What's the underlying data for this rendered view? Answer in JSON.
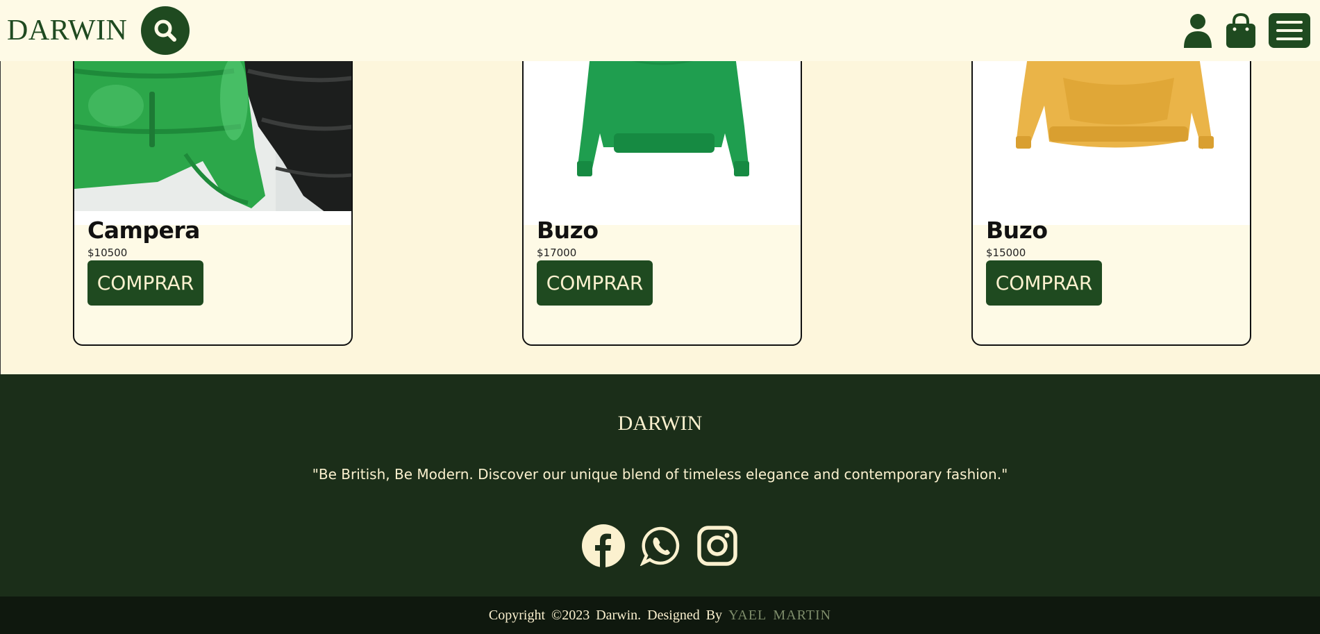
{
  "header": {
    "brand": "DARWIN",
    "icons": [
      "search-icon",
      "user-icon",
      "shopping-bag-icon",
      "menu-icon"
    ]
  },
  "products": [
    {
      "title": "Campera",
      "price": "$10500",
      "button": "COMPRAR",
      "image": "green-puffer-jacket"
    },
    {
      "title": "Buzo",
      "price": "$17000",
      "button": "COMPRAR",
      "image": "green-sweatshirt"
    },
    {
      "title": "Buzo",
      "price": "$15000",
      "button": "COMPRAR",
      "image": "yellow-hoodie"
    }
  ],
  "footer": {
    "brand": "DARWIN",
    "tagline": "\"Be British, Be Modern. Discover our unique blend of timeless elegance and contemporary fashion.\"",
    "socials": [
      "facebook-icon",
      "whatsapp-icon",
      "instagram-icon"
    ],
    "copyright_prefix": "Copyright ©2023 Darwin. Designed By",
    "designer": "YAEL MARTIN"
  },
  "colors": {
    "brand_green": "#1f4a20",
    "cream": "#fefae6",
    "footer_bg": "#1b2e19",
    "copyright_bg": "#0f180e"
  }
}
